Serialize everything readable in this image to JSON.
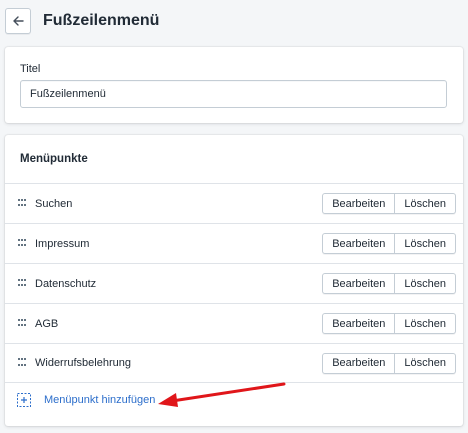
{
  "header": {
    "title": "Fußzeilenmenü"
  },
  "title_card": {
    "label": "Titel",
    "value": "Fußzeilenmenü"
  },
  "menu_card": {
    "heading": "Menüpunkte",
    "edit_label": "Bearbeiten",
    "delete_label": "Löschen",
    "items": [
      {
        "label": "Suchen"
      },
      {
        "label": "Impressum"
      },
      {
        "label": "Datenschutz"
      },
      {
        "label": "AGB"
      },
      {
        "label": "Widerrufsbelehrung"
      }
    ],
    "add_label": "Menüpunkt hinzufügen"
  },
  "colors": {
    "accent": "#2c6ecb",
    "annotation_arrow": "#e0161a"
  },
  "icons": {
    "back": "arrow-left-icon",
    "drag": "drag-handle-icon",
    "add": "add-item-icon"
  }
}
